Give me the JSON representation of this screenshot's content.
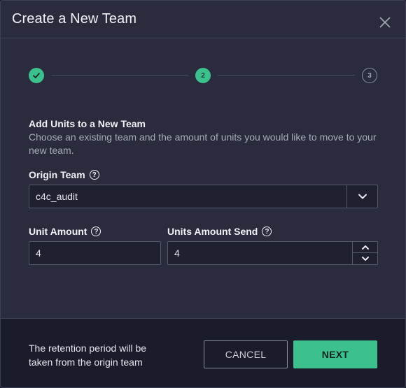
{
  "dialog": {
    "title": "Create a New Team"
  },
  "stepper": {
    "steps": [
      {
        "state": "done",
        "label": ""
      },
      {
        "state": "active",
        "label": "2"
      },
      {
        "state": "pending",
        "label": "3"
      }
    ]
  },
  "section": {
    "title": "Add Units to a New Team",
    "description": "Choose an existing team and the amount of units you would like to move to your new team."
  },
  "origin_team": {
    "label": "Origin Team",
    "value": "c4c_audit"
  },
  "unit_amount": {
    "label": "Unit Amount",
    "value": "4"
  },
  "units_amount_send": {
    "label": "Units Amount Send",
    "value": "4"
  },
  "footer": {
    "note": "The retention period will be taken from the origin team",
    "cancel_label": "CANCEL",
    "next_label": "NEXT"
  },
  "colors": {
    "accent": "#3cc18e",
    "background": "#2a2c3d",
    "footer_background": "#1b1c2b"
  },
  "icons": {
    "close": "close-icon",
    "check": "check-icon",
    "help": "help-icon",
    "chevron_down": "chevron-down-icon",
    "chevron_up": "chevron-up-icon"
  }
}
